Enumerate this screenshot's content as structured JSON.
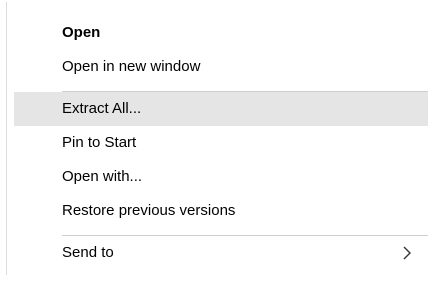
{
  "context_menu": {
    "items": [
      {
        "label": "Open"
      },
      {
        "label": "Open in new window"
      },
      {
        "label": "Extract All..."
      },
      {
        "label": "Pin to Start"
      },
      {
        "label": "Open with..."
      },
      {
        "label": "Restore previous versions"
      },
      {
        "label": "Send to"
      }
    ],
    "submenu_icon": "chevron-right-icon",
    "highlight_color": "#e5e5e5"
  }
}
